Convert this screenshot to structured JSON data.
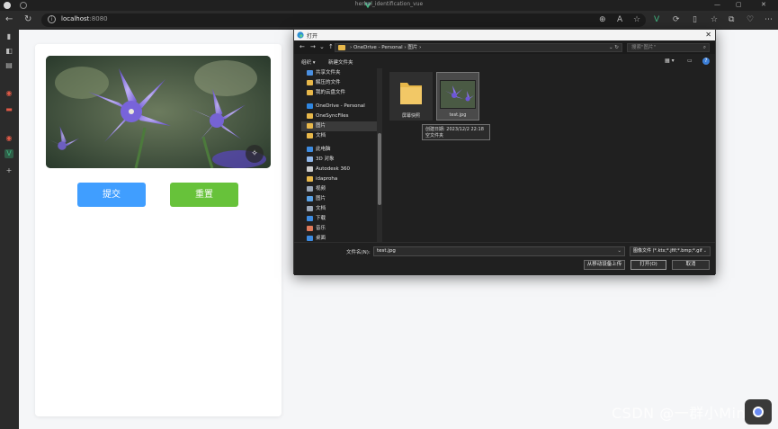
{
  "browser": {
    "tab_title": "herbal_identification_vue",
    "url_host": "localhost",
    "url_port": ":8080"
  },
  "page": {
    "submit_label": "提交",
    "reset_label": "重置"
  },
  "dialog": {
    "title": "打开",
    "breadcrumb": [
      "OneDrive - Personal",
      "图片"
    ],
    "search_placeholder": "搜索\"图片\"",
    "organize_label": "组织 ▾",
    "new_folder_label": "新建文件夹",
    "tree": [
      {
        "label": "共享文件夹",
        "icon": "share-icon"
      },
      {
        "label": "解压的文件",
        "icon": "folder-icon"
      },
      {
        "label": "我的云盘文件",
        "icon": "folder-icon"
      },
      {
        "label": "OneDrive - Personal",
        "icon": "cloud-icon"
      },
      {
        "label": "OneSyncFiles",
        "icon": "folder-icon"
      },
      {
        "label": "图片",
        "icon": "folder-icon"
      },
      {
        "label": "文档",
        "icon": "folder-icon"
      },
      {
        "label": "此电脑",
        "icon": "pc-icon"
      },
      {
        "label": "3D 对象",
        "icon": "cube-icon"
      },
      {
        "label": "Autodesk 360",
        "icon": "autodesk-icon"
      },
      {
        "label": "idaproha",
        "icon": "folder-icon"
      },
      {
        "label": "视频",
        "icon": "video-icon"
      },
      {
        "label": "图片",
        "icon": "picture-icon"
      },
      {
        "label": "文档",
        "icon": "document-icon"
      },
      {
        "label": "下载",
        "icon": "download-icon"
      },
      {
        "label": "音乐",
        "icon": "music-icon"
      },
      {
        "label": "桌面",
        "icon": "desktop-icon"
      }
    ],
    "files": [
      {
        "name": "屏幕快照",
        "type": "folder"
      },
      {
        "name": "test.jpg",
        "type": "image"
      }
    ],
    "tooltip_line1": "创建日期: 2023/12/2 22:18",
    "tooltip_line2": "空文件夹",
    "filename_label": "文件名(N):",
    "filename_value": "test.jpg",
    "filetype_value": "图像文件 (*.ktx;*.jfif;*.bmp;*.gif",
    "btn_mobile": "从移动设备上传",
    "btn_open": "打开(O)",
    "btn_cancel": "取消"
  },
  "watermark": "CSDN @一群小Ming",
  "colors": {
    "submit": "#409eff",
    "reset": "#67c23a",
    "folder": "#e8b84a",
    "dialog_bg": "#202020"
  }
}
